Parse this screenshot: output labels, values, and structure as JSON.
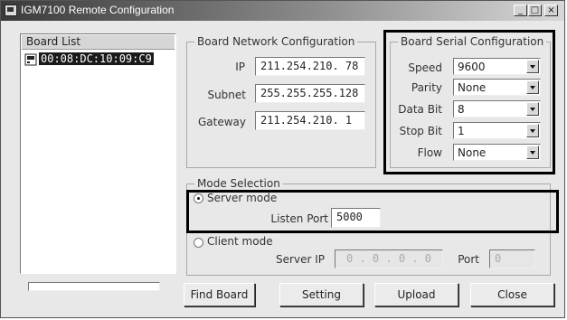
{
  "window": {
    "title": "IGM7100 Remote Configuration",
    "controls": {
      "minimize": "_",
      "maximize": "□",
      "close": "×"
    }
  },
  "board_list": {
    "header": "Board List",
    "items": [
      {
        "label": "00:08:DC:10:09:C9",
        "selected": true
      }
    ]
  },
  "network": {
    "title": "Board Network Configuration",
    "ip_label": "IP",
    "ip_value": "211.254.210. 78",
    "subnet_label": "Subnet",
    "subnet_value": "255.255.255.128",
    "gateway_label": "Gateway",
    "gateway_value": "211.254.210.  1"
  },
  "serial": {
    "title": "Board Serial Configuration",
    "speed_label": "Speed",
    "speed_value": "9600",
    "parity_label": "Parity",
    "parity_value": "None",
    "databit_label": "Data Bit",
    "databit_value": "8",
    "stopbit_label": "Stop Bit",
    "stopbit_value": "1",
    "flow_label": "Flow",
    "flow_value": "None"
  },
  "mode": {
    "title": "Mode Selection",
    "server_mode_label": "Server mode",
    "server_mode_selected": true,
    "listen_port_label": "Listen Port",
    "listen_port_value": "5000",
    "client_mode_label": "Client mode",
    "client_mode_selected": false,
    "server_ip_label": "Server IP",
    "server_ip_value": "0  .  0  .  0  .  0",
    "port_label": "Port",
    "port_value": "0"
  },
  "buttons": {
    "find_board": "Find Board",
    "setting": "Setting",
    "upload": "Upload",
    "close": "Close"
  },
  "colors": {
    "title_gradient_start": "#3a3a3a",
    "window_bg": "#e8e8e8",
    "highlight_border": "#000000",
    "list_selection": "#1a1a1a"
  }
}
